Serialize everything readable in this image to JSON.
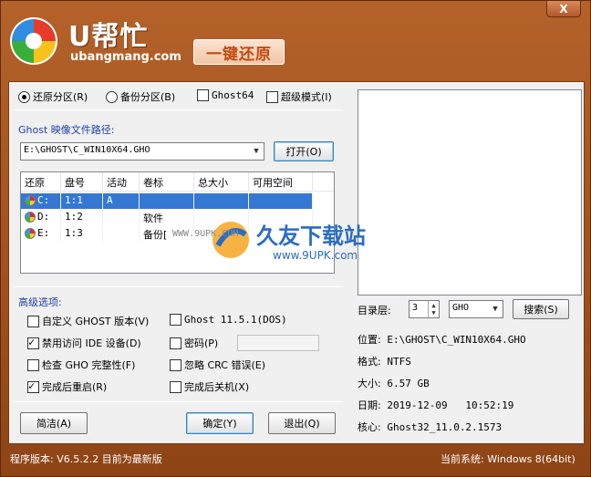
{
  "window": {
    "close_label": "X"
  },
  "brand": {
    "title": "U帮忙",
    "subtitle": "ubangmang.com",
    "mode_badge": "一键还原"
  },
  "modes": [
    {
      "label": "还原分区(R)",
      "selected": true
    },
    {
      "label": "备份分区(B)",
      "selected": false
    }
  ],
  "top_checks": [
    {
      "label": "Ghost64",
      "checked": false
    },
    {
      "label": "超级模式(I)",
      "checked": false
    }
  ],
  "ghost_path": {
    "label": "Ghost 映像文件路径:",
    "value": "E:\\GHOST\\C_WIN10X64.GHO",
    "open_button": "打开(O)"
  },
  "table": {
    "headers": [
      "还原",
      "盘号",
      "活动",
      "卷标",
      "总大小",
      "可用空间"
    ],
    "rows": [
      {
        "drive": "C:",
        "num": "1:1",
        "active": "A",
        "label": "",
        "total": "",
        "free": ""
      },
      {
        "drive": "D:",
        "num": "1:2",
        "active": "",
        "label": "软件",
        "total": "",
        "free": ""
      },
      {
        "drive": "E:",
        "num": "1:3",
        "active": "",
        "label": "备份[",
        "total": "",
        "free": ""
      }
    ]
  },
  "advanced": {
    "label": "高级选项:",
    "options": [
      {
        "label": "自定义 GHOST 版本(V)",
        "checked": false
      },
      {
        "label": "Ghost 11.5.1(DOS)",
        "checked": false
      },
      {
        "label": "禁用访问 IDE 设备(D)",
        "checked": true
      },
      {
        "label": "密码(P)",
        "checked": false
      },
      {
        "label": "检查 GHO 完整性(F)",
        "checked": false
      },
      {
        "label": "忽略 CRC 错误(E)",
        "checked": false
      },
      {
        "label": "完成后重启(R)",
        "checked": true
      },
      {
        "label": "完成后关机(X)",
        "checked": false
      }
    ]
  },
  "buttons": {
    "simple": "简洁(A)",
    "ok": "确定(Y)",
    "quit": "退出(Q)"
  },
  "dir_level": {
    "label": "目录层:",
    "value": "3",
    "filter": "GHO",
    "search": "搜索(S)"
  },
  "file_info": {
    "location_label": "位置:",
    "location": "E:\\GHOST\\C_WIN10X64.GHO",
    "format_label": "格式:",
    "format": "NTFS",
    "size_label": "大小:",
    "size": "6.57 GB",
    "date_label": "日期:",
    "date": "2019-12-09   10:52:19",
    "core_label": "核心:",
    "core": "Ghost32_11.0.2.1573"
  },
  "watermark": {
    "text": "久友下载站",
    "url": "WWW.9UPK.COM",
    "url2": "www.9UPK.com"
  },
  "statusbar": {
    "version": "程序版本: V6.5.2.2  目前为最新版",
    "system": "当前系统: Windows 8(64bit)"
  },
  "colors": {
    "frame": "#a5501e",
    "accent": "#3478d4",
    "label_blue": "#1c3fa8"
  }
}
